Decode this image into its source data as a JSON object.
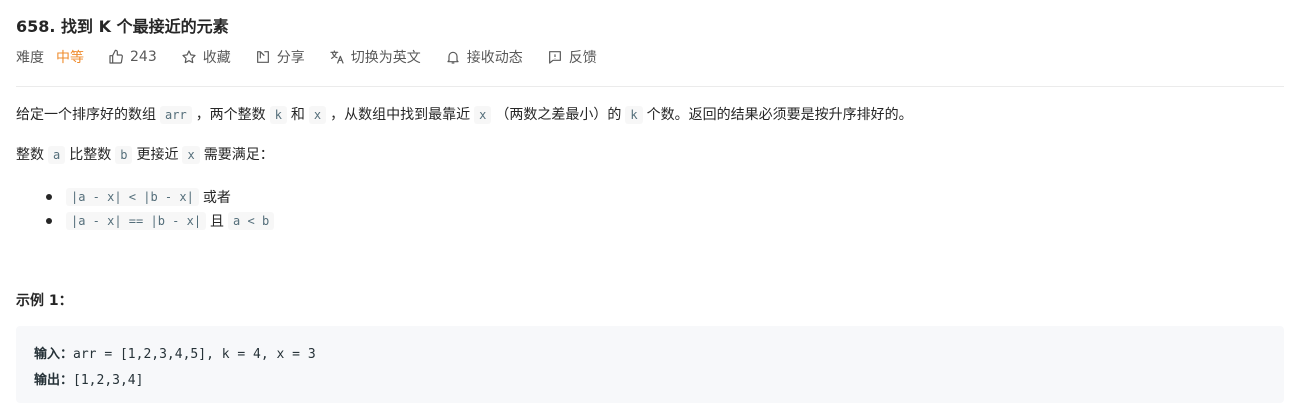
{
  "problem": {
    "title": "658. 找到 K 个最接近的元素",
    "difficulty_label": "难度",
    "difficulty_value": "中等",
    "likes": "243",
    "collect_label": "收藏",
    "share_label": "分享",
    "translate_label": "切换为英文",
    "subscribe_label": "接收动态",
    "feedback_label": "反馈",
    "difficulty_color": "#ef8c2e"
  },
  "description": {
    "p1": {
      "t1": "给定一个排序好的数组",
      "c1": "arr",
      "t2": "，两个整数",
      "c2": "k",
      "t3": "和",
      "c3": "x",
      "t4": "，从数组中找到最靠近",
      "c4": "x",
      "t5": "（两数之差最小）的",
      "c5": "k",
      "t6": "个数。返回的结果必须要是按升序排好的。"
    },
    "p2": {
      "t1": "整数",
      "c1": "a",
      "t2": "比整数",
      "c2": "b",
      "t3": "更接近",
      "c3": "x",
      "t4": "需要满足："
    },
    "cond1": {
      "code": "|a - x| < |b - x|",
      "text": "或者"
    },
    "cond2": {
      "code1": "|a - x| == |b - x|",
      "text": "且",
      "code2": "a < b"
    }
  },
  "example1": {
    "title": "示例 1：",
    "input_label": "输入：",
    "input_value": "arr = [1,2,3,4,5], k = 4, x = 3",
    "output_label": "输出：",
    "output_value": "[1,2,3,4]"
  },
  "icons": {
    "like": "thumbs-up-icon",
    "collect": "star-icon",
    "share": "share-icon",
    "translate": "translate-icon",
    "subscribe": "bell-icon",
    "feedback": "feedback-icon"
  }
}
